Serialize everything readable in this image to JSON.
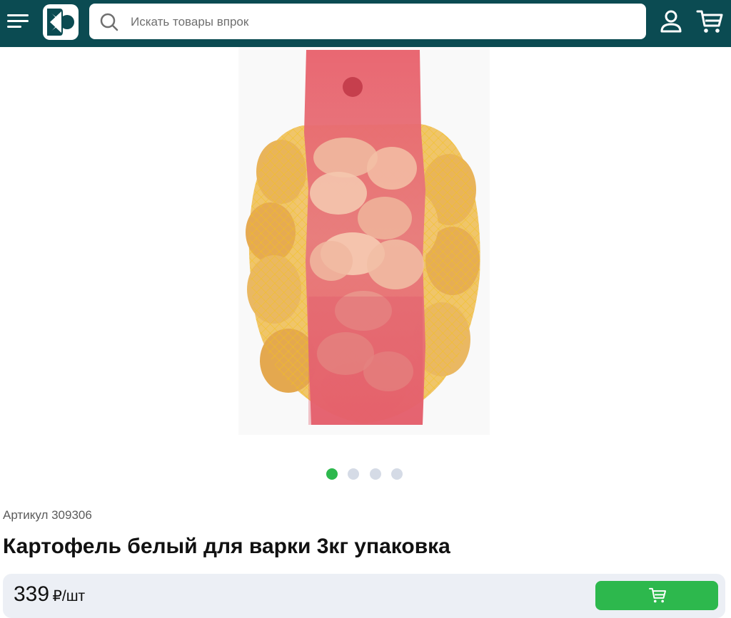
{
  "header": {
    "search": {
      "placeholder": "Искать товары впрок"
    },
    "icons": [
      "menu-icon",
      "logo",
      "search-icon",
      "user-icon",
      "cart-icon"
    ]
  },
  "gallery": {
    "slide_count": 4,
    "active_index": 0
  },
  "product": {
    "sku_text": "Артикул 309306",
    "title": "Картофель белый для варки 3кг упаковка",
    "price": "339",
    "price_unit": "₽/шт"
  },
  "colors": {
    "header_bg": "#0b4b52",
    "accent": "#2db84d",
    "dot_inactive": "#d5dbe6",
    "price_bar_bg": "#eceff5"
  }
}
